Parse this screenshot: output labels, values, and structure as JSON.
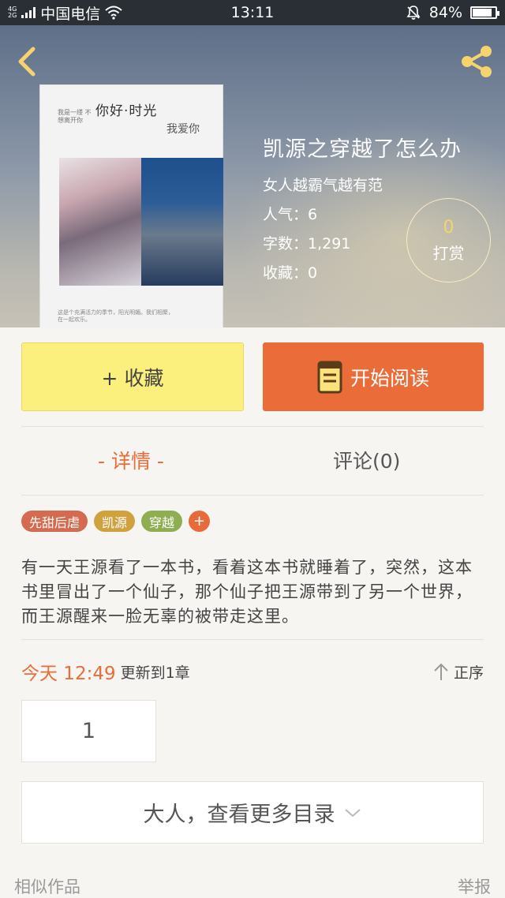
{
  "status_bar": {
    "network_type_top": "4G",
    "network_type_bottom": "2G",
    "carrier": "中国电信",
    "time": "13:11",
    "battery_percent": "84%",
    "battery_level": 0.84,
    "icons": [
      "signal-icon",
      "wifi-icon",
      "mute-bell-icon",
      "battery-icon"
    ]
  },
  "header": {
    "back_icon": "chevron-left-icon",
    "share_icon": "share-icon",
    "cover": {
      "title": "你好·时光",
      "subtitle": "我爱你",
      "tiny_text": "我是一缕 不想离开你",
      "bottom_text": "这是个充满活力的季节，阳光明媚。我们相聚，在一起欢乐。"
    },
    "book": {
      "title": "凯源之穿越了怎么办",
      "author": "女人越霸气越有范",
      "popularity": "人气：6",
      "word_count": "字数：1,291",
      "favorites": "收藏：0"
    },
    "reward": {
      "count": "0",
      "label": "打赏"
    }
  },
  "actions": {
    "collect_label": "+ 收藏",
    "read_label": "开始阅读"
  },
  "tabs": {
    "detail": "- 详情 -",
    "comments": "评论(0)"
  },
  "tags": [
    {
      "label": "先甜后虐",
      "color": "#d46a4f"
    },
    {
      "label": "凯源",
      "color": "#d0a23f"
    },
    {
      "label": "穿越",
      "color": "#8fae52"
    }
  ],
  "tag_add": "+",
  "description": "有一天王源看了一本书，看着这本书就睡着了，突然，这本书里冒出了一个仙子，那个仙子把王源带到了另一个世界，而王源醒来一脸无辜的被带走这里。",
  "update": {
    "time": "今天 12:49",
    "text": "更新到1章",
    "sort_label": "正序"
  },
  "chapter": "1",
  "more_toc": "大人，查看更多目录",
  "footer": {
    "similar": "相似作品",
    "report": "举报"
  },
  "colors": {
    "accent": "#ea6c38",
    "collect_bg": "#fbef7d",
    "reward_count": "#f5d36d"
  }
}
